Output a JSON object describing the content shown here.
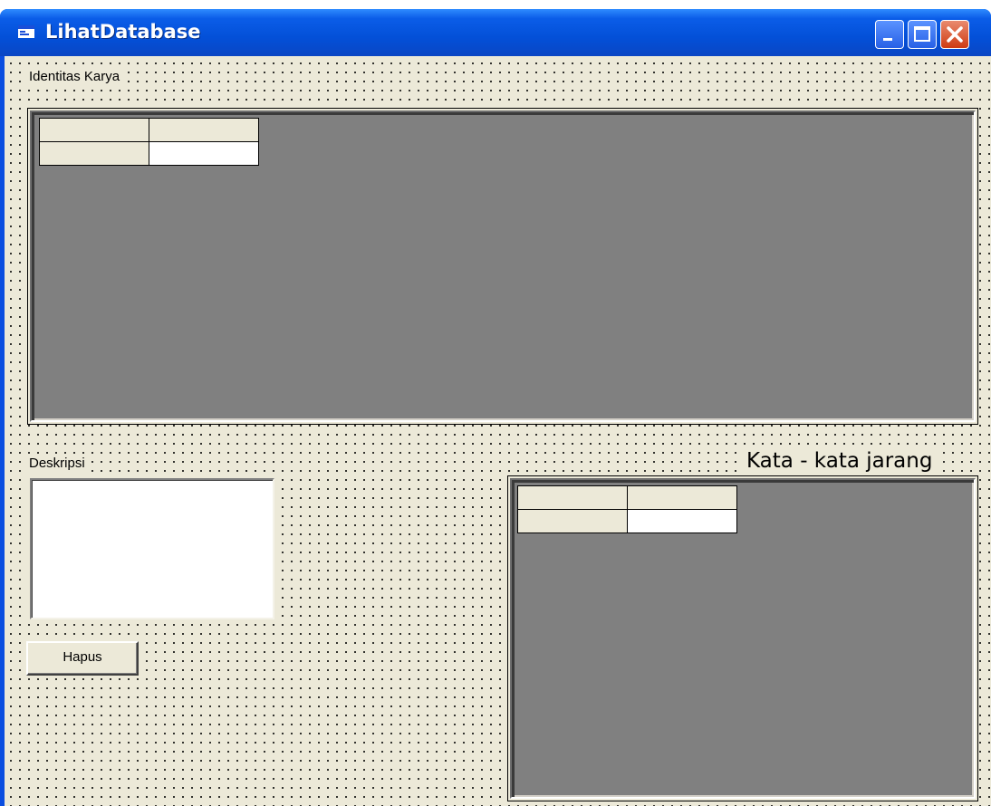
{
  "window": {
    "title": "LihatDatabase",
    "icon": "form-icon",
    "controls": [
      "minimize-icon",
      "maximize-icon",
      "close-icon"
    ],
    "title_bar_color": "#0a4ee0",
    "client_color": "#ece9d8"
  },
  "form": {
    "identitas_label": "Identitas Karya",
    "deskripsi_label": "Deskripsi",
    "kata_label": "Kata - kata jarang",
    "hapus_button": "Hapus",
    "deskripsi_value": "",
    "grid_background": "#808080"
  }
}
